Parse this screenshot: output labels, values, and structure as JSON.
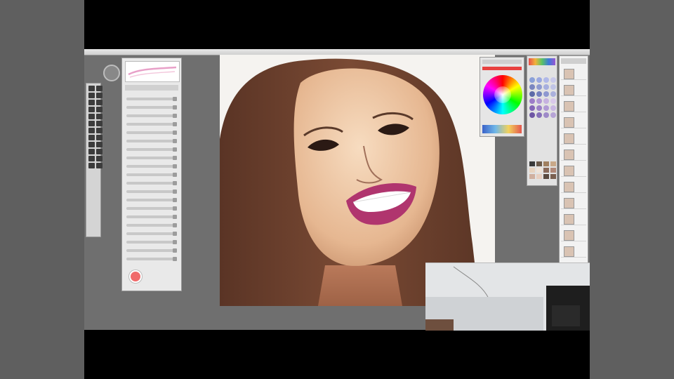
{
  "app": {
    "title": "",
    "accent_color": "#e8413f"
  },
  "toolbar": {
    "buttons": [
      "arrow-icon",
      "brush-icon",
      "eraser-icon",
      "fill-icon",
      "select-icon",
      "move-icon",
      "zoom-icon",
      "hand-icon",
      "rotate-icon",
      "eyedropper-icon",
      "text-icon",
      "undo-icon",
      "redo-icon",
      "grid-icon",
      "ruler-icon",
      "layer-icon",
      "save-icon"
    ]
  },
  "tools": {
    "count": 24
  },
  "brush_panel": {
    "preview_color": "#e8a0c8",
    "active_color": "#f06a6a"
  },
  "color_panel": {
    "current_color": "#e8413f"
  },
  "swatches": {
    "colors": [
      "#8aa0d8",
      "#9aa8e0",
      "#b0b8e8",
      "#c8c8ea",
      "#7a86c0",
      "#8f9ad0",
      "#a6aede",
      "#c0c4e6",
      "#5d6aa8",
      "#7480bf",
      "#8e98d0",
      "#aab0dc",
      "#9c7cc8",
      "#b096d4",
      "#c6b2e0",
      "#d8c8ea",
      "#8466b8",
      "#9a80c6",
      "#b09ad4",
      "#c8b6e2",
      "#6e56a4",
      "#8670b8",
      "#9e8ac8",
      "#b6a4d6"
    ],
    "palette": [
      "#3a3a3a",
      "#6b5a4a",
      "#a08060",
      "#c8a888",
      "#e8d4c0",
      "#f0e4d8",
      "#8a6a5a",
      "#b08878",
      "#d0b0a0",
      "#e8cfc0",
      "#5a4a40",
      "#7a6050"
    ]
  },
  "layers": {
    "count": 12
  }
}
